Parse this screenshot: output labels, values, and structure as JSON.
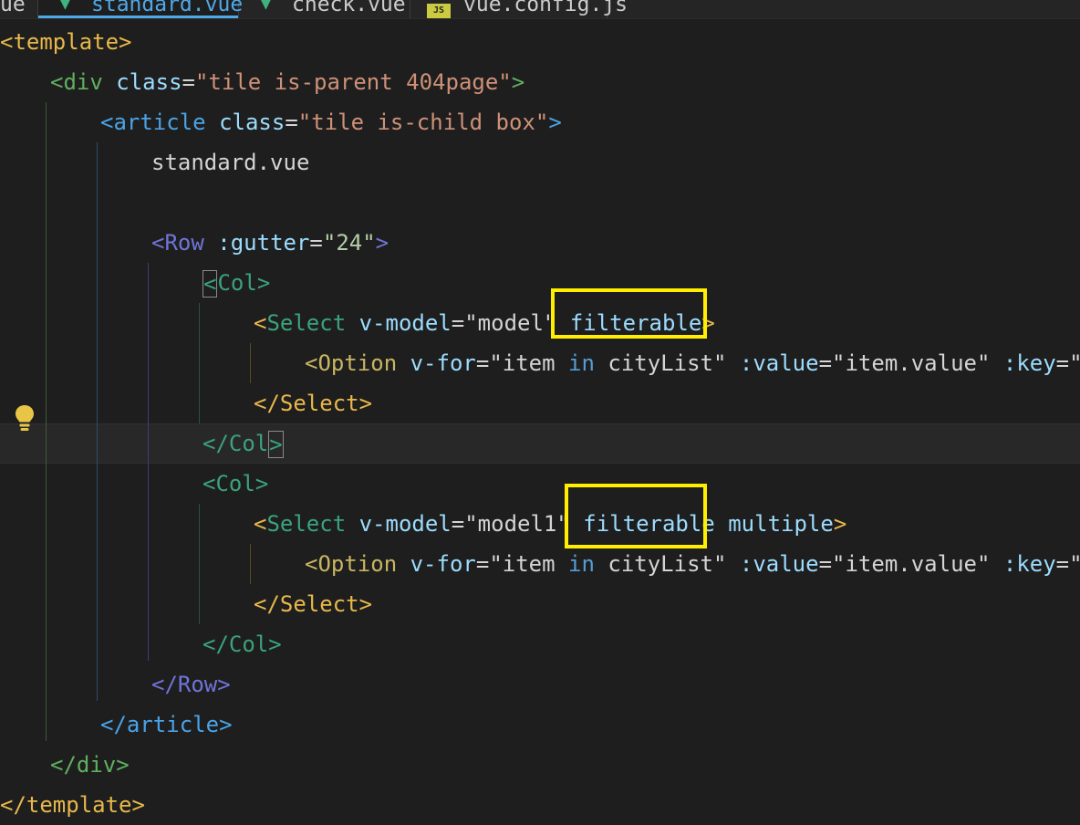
{
  "tabs": [
    {
      "label": "ue",
      "icon": "none",
      "active": false
    },
    {
      "label": "standard.vue",
      "icon": "vue-file-icon",
      "active": true
    },
    {
      "label": "check.vue",
      "icon": "vue-file-icon",
      "active": false
    },
    {
      "label": "vue.config.js",
      "icon": "js-file-icon",
      "active": false
    }
  ],
  "code": {
    "l1_open": "<",
    "l1_tag": "template",
    "l1_close": ">",
    "l2_open": "<",
    "l2_tag": "div",
    "l2_attr": "class",
    "l2_eq": "=",
    "l2_val": "\"tile is-parent 404page\"",
    "l2_close": ">",
    "l3_open": "<",
    "l3_tag": "article",
    "l3_attr": "class",
    "l3_eq": "=",
    "l3_val": "\"tile is-child box\"",
    "l3_close": ">",
    "l4_text": "standard.vue",
    "l6_open": "<",
    "l6_tag": "Row",
    "l6_attr": ":gutter",
    "l6_eq": "=",
    "l6_val": "\"24\"",
    "l6_close": ">",
    "l7_open": "<",
    "l7_tag": "Col",
    "l7_close": ">",
    "l8_open": "<",
    "l8_tag": "Select",
    "l8_attr": "v-model",
    "l8_eq": "=",
    "l8_val": "\"model\"",
    "l8_attr2": "filterable",
    "l8_close": ">",
    "l9_open": "<",
    "l9_tag": "Option",
    "l9_attr": "v-for",
    "l9_eq": "=",
    "l9_q1": "\"item ",
    "l9_in": "in",
    "l9_list": " cityList",
    "l9_q2": "\"",
    "l9_attr2": ":value",
    "l9_eq2": "=",
    "l9_val2": "\"item.value\"",
    "l9_attr3": ":key",
    "l9_eq3": "=",
    "l9_val3": "\"it",
    "l10_open": "</",
    "l10_tag": "Select",
    "l10_close": ">",
    "l11_open": "</",
    "l11_tag": "Col",
    "l11_close": ">",
    "l12_open": "<",
    "l12_tag": "Col",
    "l12_close": ">",
    "l13_open": "<",
    "l13_tag": "Select",
    "l13_attr": "v-model",
    "l13_eq": "=",
    "l13_val": "\"model1\"",
    "l13_attr2": "filterable",
    "l13_attr3": "multiple",
    "l13_close": ">",
    "l14_open": "<",
    "l14_tag": "Option",
    "l14_attr": "v-for",
    "l14_eq": "=",
    "l14_q1": "\"item ",
    "l14_in": "in",
    "l14_list": " cityList",
    "l14_q2": "\"",
    "l14_attr2": ":value",
    "l14_eq2": "=",
    "l14_val2": "\"item.value\"",
    "l14_attr3": ":key",
    "l14_eq3": "=",
    "l14_val3": "\"it",
    "l15_open": "</",
    "l15_tag": "Select",
    "l15_close": ">",
    "l16_open": "</",
    "l16_tag": "Col",
    "l16_close": ">",
    "l17_open": "</",
    "l17_tag": "Row",
    "l17_close": ">",
    "l18_open": "</",
    "l18_tag": "article",
    "l18_close": ">",
    "l19_open": "</",
    "l19_tag": "div",
    "l19_close": ">",
    "l20_open": "</",
    "l20_tag": "template",
    "l20_close": ">"
  },
  "colors": {
    "background": "#1e1e1e",
    "highlight": "#ffee00",
    "lightbulb": "#e8c547"
  },
  "icons": {
    "lightbulb": "lightbulb-icon"
  }
}
